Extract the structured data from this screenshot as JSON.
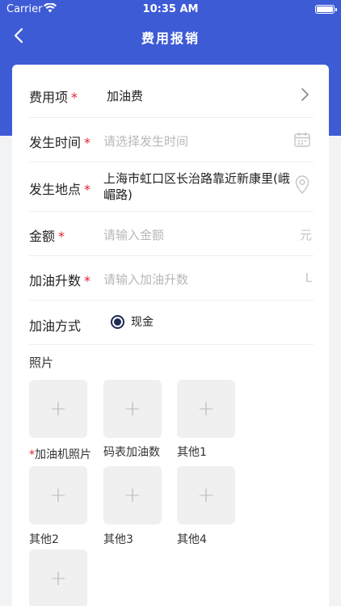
{
  "status_bar": {
    "carrier": "Carrier",
    "time": "10:35 AM"
  },
  "nav": {
    "title": "费用报销"
  },
  "form": {
    "expense_item": {
      "label": "费用项",
      "required": "*",
      "value": "加油费"
    },
    "occur_time": {
      "label": "发生时间",
      "required": "*",
      "placeholder": "请选择发生时间"
    },
    "occur_place": {
      "label": "发生地点",
      "required": "*",
      "value": "上海市虹口区长治路靠近新康里(峨嵋路)"
    },
    "amount": {
      "label": "金额",
      "required": "*",
      "placeholder": "请输入金额",
      "unit": "元"
    },
    "liters": {
      "label": "加油升数",
      "required": "*",
      "placeholder": "请输入加油升数",
      "unit": "L"
    },
    "payment": {
      "label": "加油方式",
      "option": "现金"
    }
  },
  "photos": {
    "title": "照片",
    "items": [
      {
        "label": "加油机照片",
        "required": "*"
      },
      {
        "label": "码表加油数"
      },
      {
        "label": "其他1"
      },
      {
        "label": "其他2"
      },
      {
        "label": "其他3"
      },
      {
        "label": "其他4"
      },
      {
        "label": ""
      }
    ]
  },
  "colors": {
    "header": "#3e5bd6",
    "required": "#e0202f",
    "radio": "#1f2a56"
  }
}
